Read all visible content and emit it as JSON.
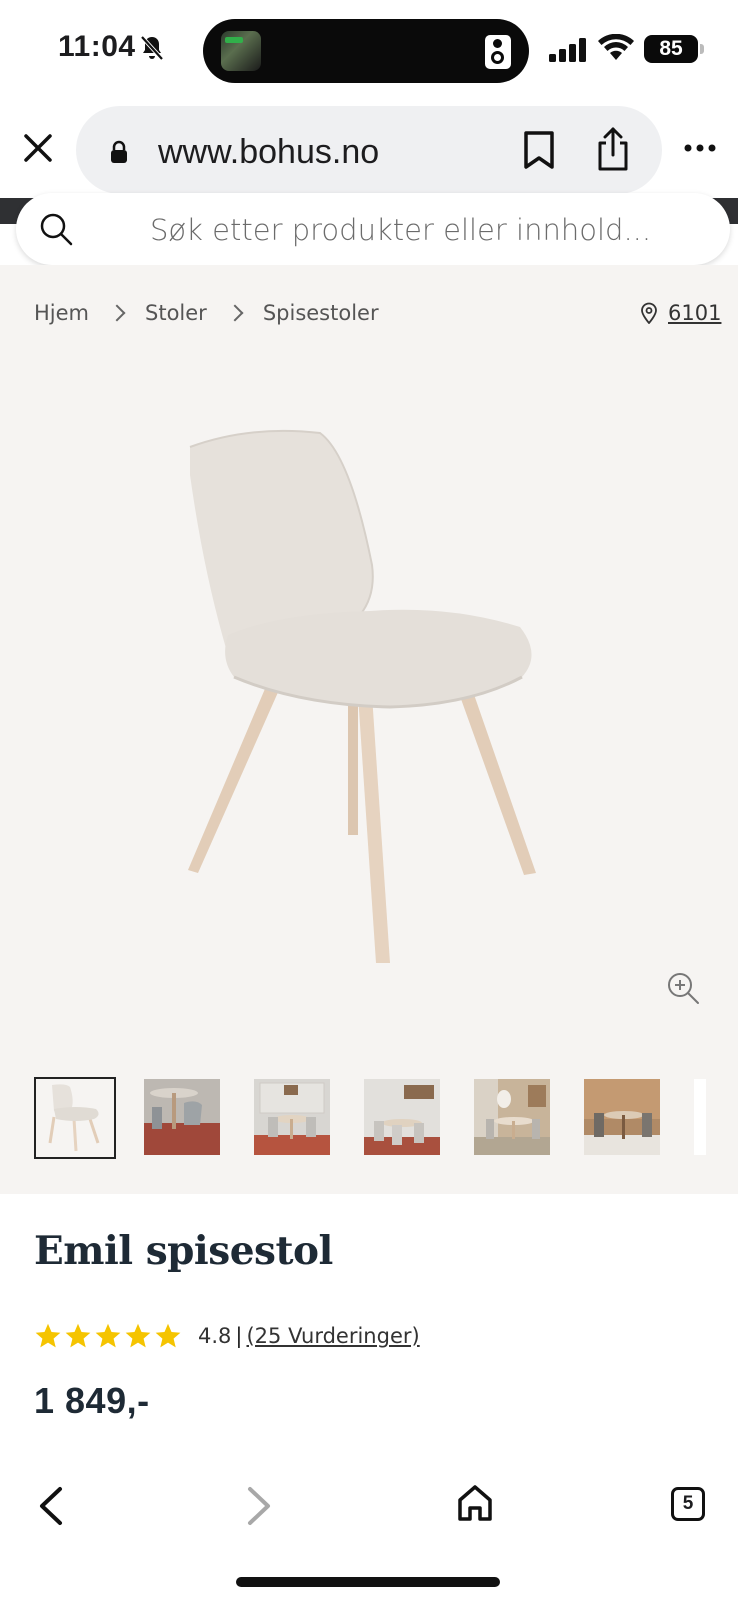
{
  "status_bar": {
    "time": "11:04",
    "battery": "85"
  },
  "browser": {
    "url": "www.bohus.no",
    "tab_count": "5"
  },
  "search": {
    "placeholder": "Søk etter produkter eller innhold..."
  },
  "breadcrumb": {
    "items": [
      "Hjem",
      "Stoler",
      "Spisestoler"
    ],
    "location_code": "6101"
  },
  "gallery": {
    "thumbnail_count": 7,
    "active_index": 0
  },
  "product": {
    "title": "Emil spisestol",
    "rating_value": "4.8",
    "rating_separator": "|",
    "rating_count_label": "(25 Vurderinger)",
    "stars": 5,
    "price": "1 849,-"
  },
  "colors": {
    "star": "#f5c400",
    "title": "#1e2a35",
    "gallery_bg": "#f6f4f2",
    "chair_fabric": "#e4dfd9",
    "chair_wood": "#e6d3c0"
  }
}
